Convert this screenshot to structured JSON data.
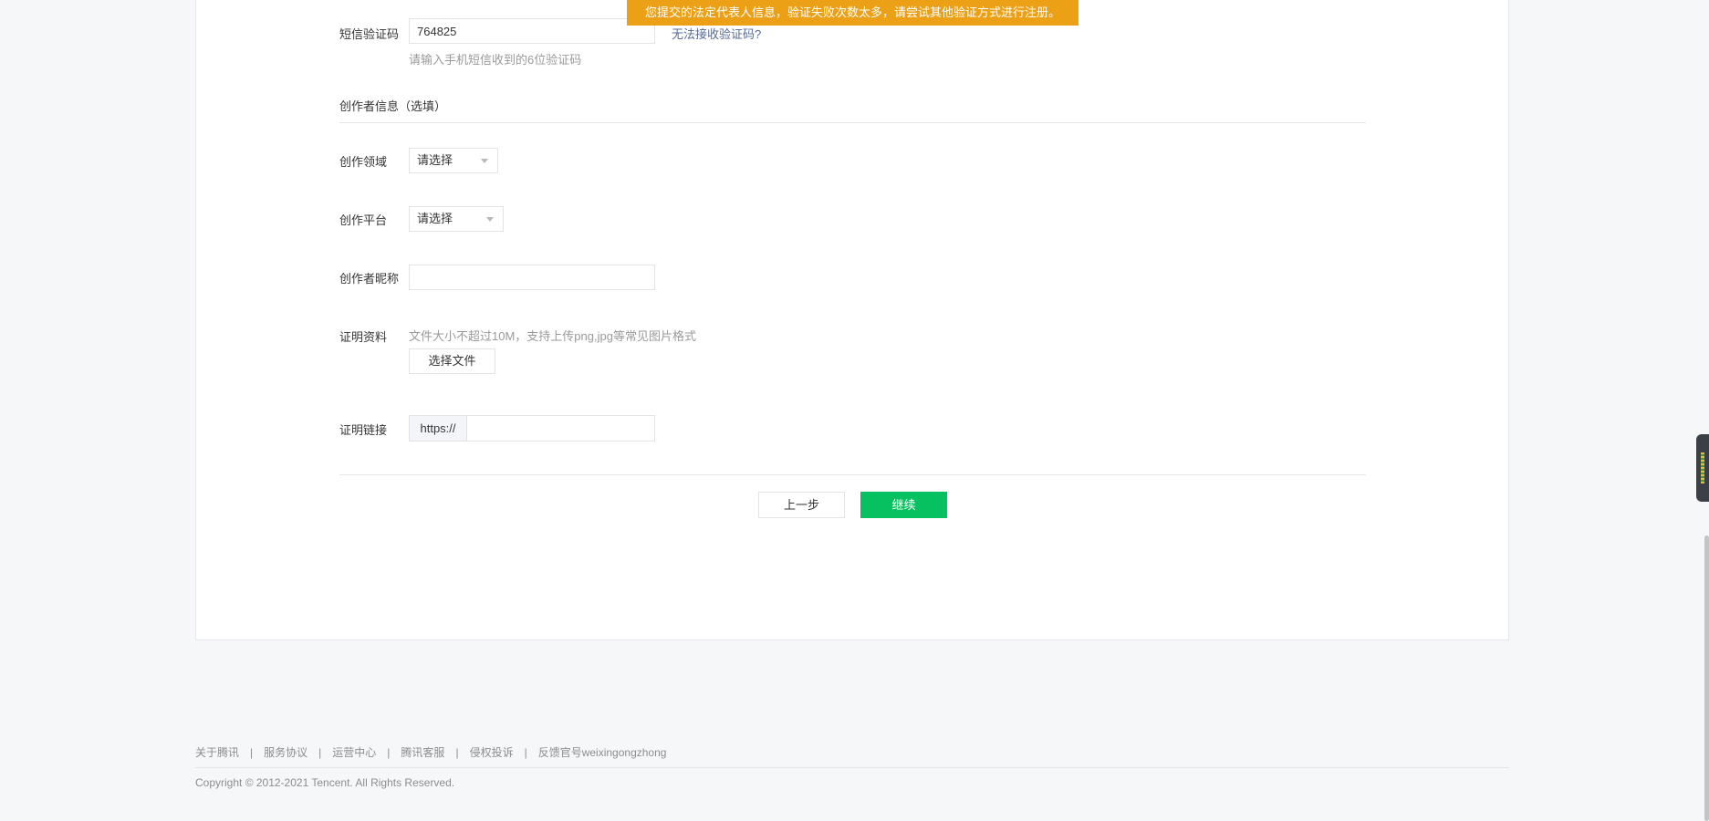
{
  "toast": {
    "message": "您提交的法定代表人信息，验证失败次数太多，请尝试其他验证方式进行注册。"
  },
  "sms": {
    "label": "短信验证码",
    "value": "764825",
    "hint": "请输入手机短信收到的6位验证码",
    "cant_receive_link": "无法接收验证码?"
  },
  "creator": {
    "section_title": "创作者信息（选填）",
    "field_label": "创作领域",
    "field_value": "请选择",
    "platform_label": "创作平台",
    "platform_value": "请选择",
    "nickname_label": "创作者昵称",
    "nickname_value": "",
    "proof_label": "证明资料",
    "proof_hint": "文件大小不超过10M，支持上传png,jpg等常见图片格式",
    "choose_file_label": "选择文件",
    "link_label": "证明链接",
    "link_prefix": "https://",
    "link_value": ""
  },
  "actions": {
    "prev_label": "上一步",
    "next_label": "继续"
  },
  "footer": {
    "links": [
      "关于腾讯",
      "服务协议",
      "运营中心",
      "腾讯客服",
      "侵权投诉",
      "反馈官号weixingongzhong"
    ],
    "separator": "|",
    "copyright": "Copyright © 2012-2021 Tencent. All Rights Reserved."
  },
  "colors": {
    "toast_bg": "#eba016",
    "primary_button": "#07c160",
    "link": "#576b95"
  }
}
